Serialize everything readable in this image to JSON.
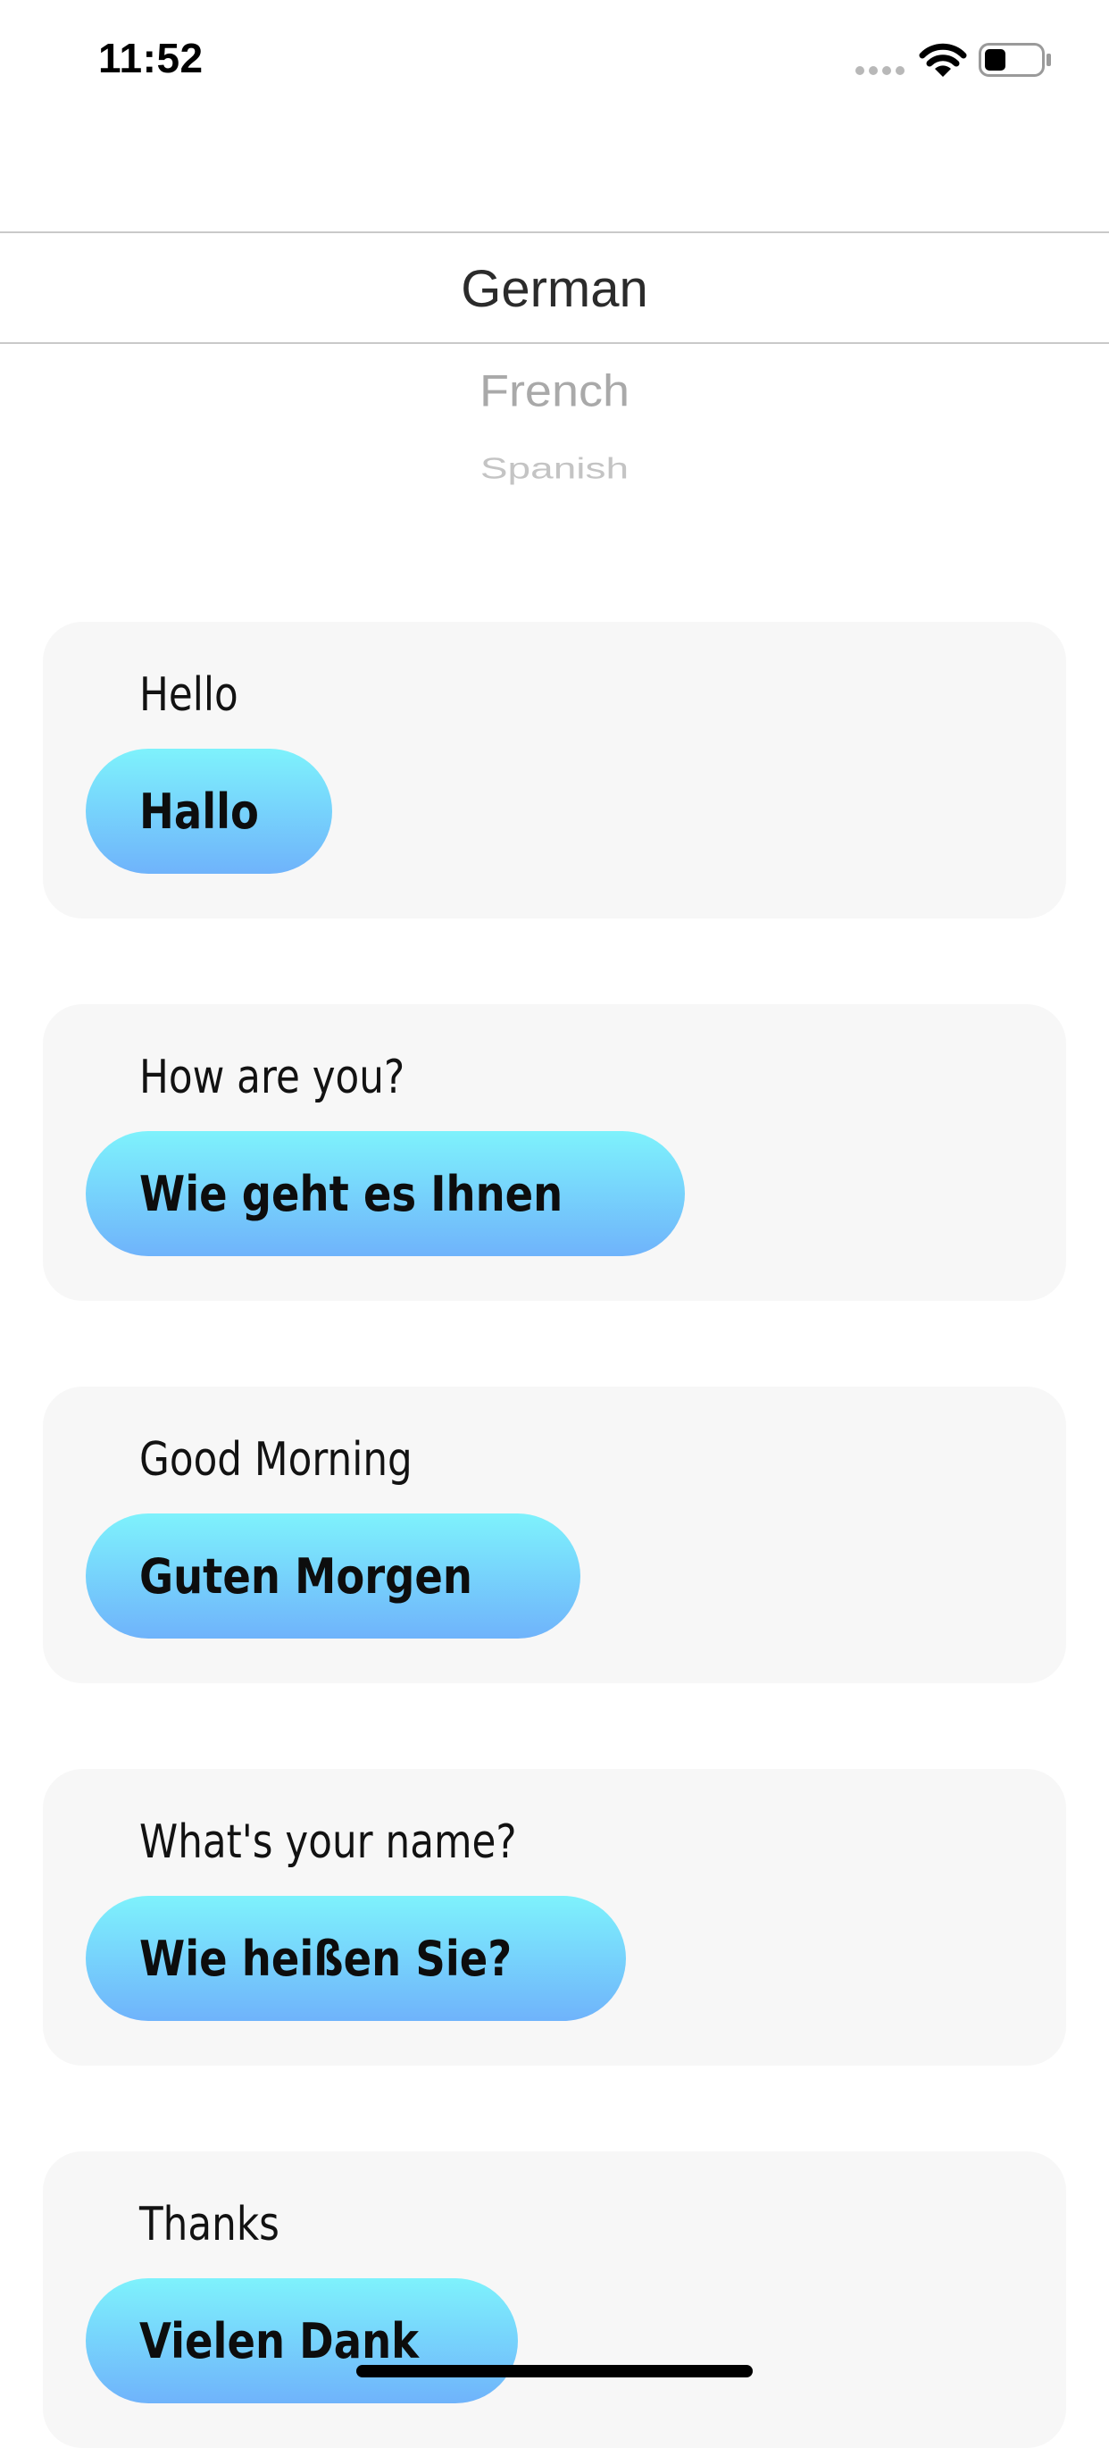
{
  "status_bar": {
    "time": "11:52",
    "icons": [
      "signal-icon",
      "wifi-icon",
      "battery-icon"
    ],
    "battery_level": 0.35
  },
  "language_picker": {
    "selected": "German",
    "options": [
      "German",
      "French",
      "Spanish"
    ]
  },
  "phrases": [
    {
      "source": "Hello",
      "translation": "Hallo"
    },
    {
      "source": "How are you?",
      "translation": "Wie geht es Ihnen"
    },
    {
      "source": "Good Morning",
      "translation": "Guten Morgen"
    },
    {
      "source": "What's your name?",
      "translation": "Wie heißen Sie?"
    },
    {
      "source": "Thanks",
      "translation": "Vielen Dank"
    }
  ],
  "colors": {
    "card_background": "#f7f7f7",
    "translation_gradient_top": "#7ef2fc",
    "translation_gradient_bottom": "#6fb3fb",
    "picker_divider": "#c9c9c9"
  }
}
